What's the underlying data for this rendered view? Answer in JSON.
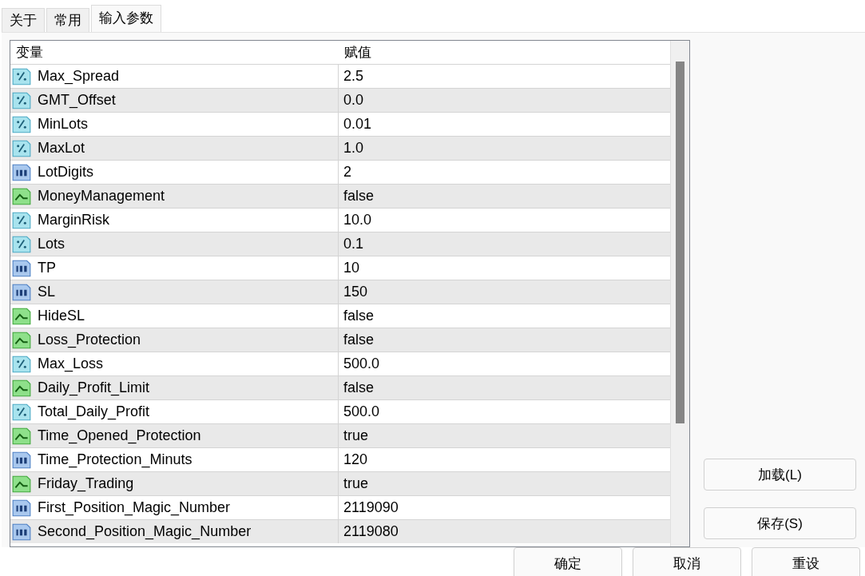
{
  "tabs": [
    {
      "label": "关于",
      "selected": false
    },
    {
      "label": "常用",
      "selected": false
    },
    {
      "label": "输入参数",
      "selected": true
    }
  ],
  "table": {
    "columns": [
      "变量",
      "赋值"
    ],
    "rows": [
      {
        "kind": "double",
        "name": "Max_Spread",
        "value": "2.5"
      },
      {
        "kind": "double",
        "name": "GMT_Offset",
        "value": "0.0"
      },
      {
        "kind": "double",
        "name": "MinLots",
        "value": "0.01"
      },
      {
        "kind": "double",
        "name": "MaxLot",
        "value": "1.0"
      },
      {
        "kind": "int",
        "name": "LotDigits",
        "value": "2"
      },
      {
        "kind": "bool",
        "name": "MoneyManagement",
        "value": "false"
      },
      {
        "kind": "double",
        "name": "MarginRisk",
        "value": "10.0"
      },
      {
        "kind": "double",
        "name": "Lots",
        "value": "0.1"
      },
      {
        "kind": "int",
        "name": "TP",
        "value": "10"
      },
      {
        "kind": "int",
        "name": "SL",
        "value": "150"
      },
      {
        "kind": "bool",
        "name": "HideSL",
        "value": "false"
      },
      {
        "kind": "bool",
        "name": "Loss_Protection",
        "value": "false"
      },
      {
        "kind": "double",
        "name": "Max_Loss",
        "value": "500.0"
      },
      {
        "kind": "bool",
        "name": "Daily_Profit_Limit",
        "value": "false"
      },
      {
        "kind": "double",
        "name": "Total_Daily_Profit",
        "value": "500.0"
      },
      {
        "kind": "bool",
        "name": "Time_Opened_Protection",
        "value": "true"
      },
      {
        "kind": "int",
        "name": "Time_Protection_Minuts",
        "value": "120"
      },
      {
        "kind": "bool",
        "name": "Friday_Trading",
        "value": "true"
      },
      {
        "kind": "int",
        "name": "First_Position_Magic_Number",
        "value": "2119090"
      },
      {
        "kind": "int",
        "name": "Second_Position_Magic_Number",
        "value": "2119080"
      }
    ]
  },
  "side_buttons": [
    "加载(L)",
    "保存(S)"
  ],
  "bottom_buttons": [
    "确定",
    "取消",
    "重设"
  ]
}
